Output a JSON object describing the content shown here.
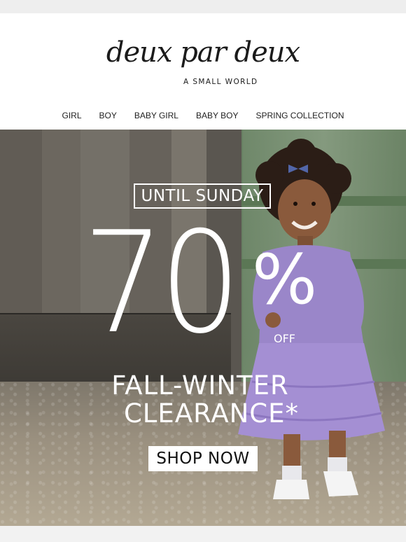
{
  "brand": {
    "name": "deux par deux",
    "tagline": "A SMALL WORLD"
  },
  "nav": {
    "items": [
      {
        "label": "GIRL"
      },
      {
        "label": "BOY"
      },
      {
        "label": "BABY GIRL"
      },
      {
        "label": "BABY BOY"
      },
      {
        "label": "SPRING COLLECTION"
      }
    ]
  },
  "hero": {
    "badge": "UNTIL SUNDAY",
    "discount": "70",
    "percent": "%",
    "off": "OFF",
    "headline_line1": "FALL-WINTER",
    "headline_line2": "CLEARANCE*",
    "cta": "SHOP NOW"
  },
  "colors": {
    "text_dark": "#1b1b1b",
    "hero_text": "#ffffff",
    "dress_purple": "#a48fd3"
  }
}
